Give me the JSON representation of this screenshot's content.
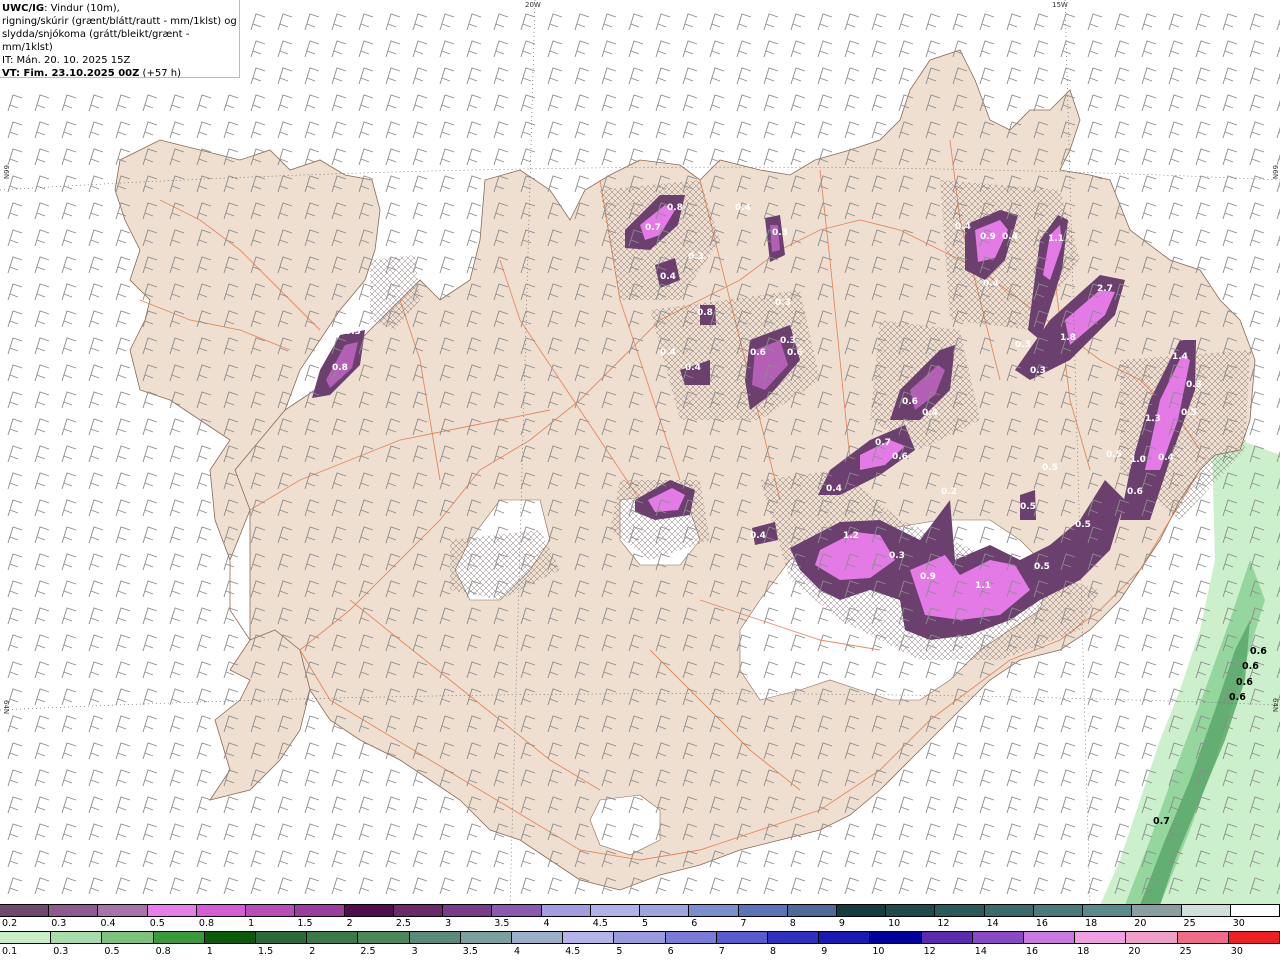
{
  "title": {
    "model": "UWC/IG",
    "line1_rest": ": Vindur (10m),",
    "line2": "rigning/skúrir (grænt/blátt/rautt - mm/1klst) og",
    "line3": "slydda/snjókoma (grátt/bleikt/grænt - mm/1klst)",
    "line4": "IT: Mán. 20. 10. 2025 15Z",
    "line5_bold": "VT: Fim. 23.10.2025 00Z",
    "line5_rest": " (+57 h)"
  },
  "graticule": {
    "lon_top": [
      "20W",
      "15W"
    ],
    "lat_left": [
      "66N",
      "64N"
    ],
    "lat_right": [
      "66N",
      "64N"
    ]
  },
  "colors": {
    "land": "#efdfd0",
    "roads": "#e27a4a",
    "coast": "#8a6a55",
    "glacier": "#ffffff",
    "sea": "#ffffff",
    "barb": "#8c8c8c",
    "snow_purple_1": "#6b3f6e",
    "snow_purple_2": "#a256a8",
    "snow_purple_3": "#e877e8",
    "rain_green_1": "#c9efc9",
    "rain_green_2": "#7fcf8a"
  },
  "snow_labels": [
    "0.3",
    "0.7",
    "0.4",
    "0.3",
    "0.4",
    "0.3",
    "0.8",
    "0.4",
    "0.3",
    "0.4",
    "0.6",
    "0.3",
    "0.6",
    "0.8",
    "0.9",
    "0.4",
    "1.1",
    "0.4",
    "2.7",
    "0.3",
    "1.8",
    "0.3",
    "1.4",
    "0.3",
    "0.6",
    "0.4",
    "0.5",
    "1.3",
    "0.7",
    "0.6",
    "0.5",
    "1.0",
    "0.4",
    "0.6",
    "0.5",
    "0.4",
    "0.2",
    "0.5",
    "0.5",
    "1.2",
    "0.4",
    "0.9",
    "1.1",
    "0.5",
    "0.3",
    "0.8",
    "0.4"
  ],
  "sea_labels": [
    "0.6",
    "0.6",
    "0.6",
    "0.6",
    "0.7"
  ],
  "legend_snow": {
    "labels": [
      "0.2",
      "0.3",
      "0.4",
      "0.5",
      "0.8",
      "1",
      "1.5",
      "2",
      "2.5",
      "3",
      "3.5",
      "4",
      "4.5",
      "5",
      "6",
      "7",
      "8",
      "9",
      "10",
      "12",
      "14",
      "16",
      "18",
      "20",
      "25",
      "30"
    ],
    "colors": [
      "#6b4a6e",
      "#8c5a8e",
      "#a873a8",
      "#e77de8",
      "#d65cd6",
      "#b94cb9",
      "#9c3c9c",
      "#4f0f4f",
      "#6a2a6a",
      "#7a3c8a",
      "#8a5ab0",
      "#a39cde",
      "#b2b2ea",
      "#9ea6e0",
      "#7c8ed0",
      "#5d73b8",
      "#4f6a9a",
      "#163c40",
      "#1f4a4a",
      "#2a5a5a",
      "#3a6a6a",
      "#4a7a7a",
      "#5a8a8a",
      "#8aa0a0",
      "#cfe0d8",
      "#ffffff"
    ]
  },
  "legend_rain": {
    "labels": [
      "0.1",
      "0.3",
      "0.5",
      "0.8",
      "1",
      "1.5",
      "2",
      "2.5",
      "3",
      "3.5",
      "4",
      "4.5",
      "5",
      "6",
      "7",
      "8",
      "9",
      "10",
      "12",
      "14",
      "16",
      "18",
      "20",
      "25",
      "30"
    ],
    "colors": [
      "#c8f0c8",
      "#a8dca8",
      "#7cc47c",
      "#3a9a3a",
      "#0a5a0a",
      "#2a6a3a",
      "#3a7a4a",
      "#4a8a5a",
      "#5a8a7a",
      "#7aa0a0",
      "#9ab0c8",
      "#b4b4ea",
      "#9a9ae0",
      "#7a7ad8",
      "#5a5ad0",
      "#3030c0",
      "#1a1ab0",
      "#00009a",
      "#5a2ab0",
      "#8a4ac8",
      "#c878e0",
      "#f0a0e0",
      "#f0a0c8",
      "#f06a8a",
      "#f02020"
    ]
  }
}
